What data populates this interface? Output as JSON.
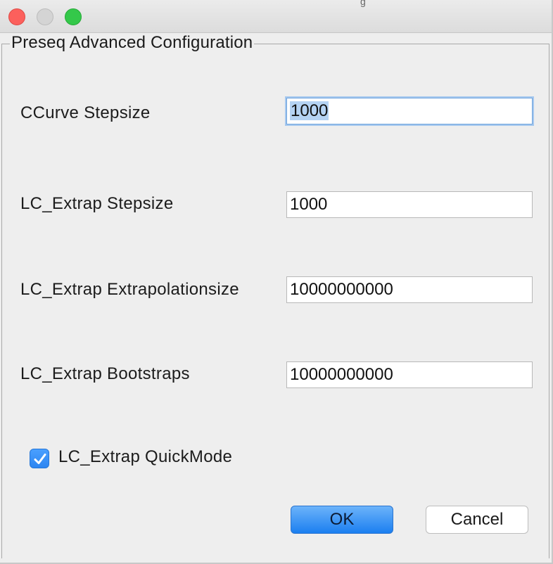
{
  "window": {
    "title_fragment": "g"
  },
  "panel": {
    "legend": "Preseq Advanced Configuration"
  },
  "fields": [
    {
      "label": "CCurve Stepsize",
      "value": "1000"
    },
    {
      "label": "LC_Extrap Stepsize",
      "value": "1000"
    },
    {
      "label": "LC_Extrap Extrapolationsize",
      "value": "10000000000"
    },
    {
      "label": "LC_Extrap Bootstraps",
      "value": "10000000000"
    }
  ],
  "quickmode": {
    "label": "LC_Extrap QuickMode",
    "checked": true
  },
  "buttons": {
    "ok": "OK",
    "cancel": "Cancel"
  },
  "colors": {
    "accent": "#2d86f1",
    "selection": "#b5d3f3",
    "close": "#fc605c",
    "maximize": "#34c84a"
  }
}
